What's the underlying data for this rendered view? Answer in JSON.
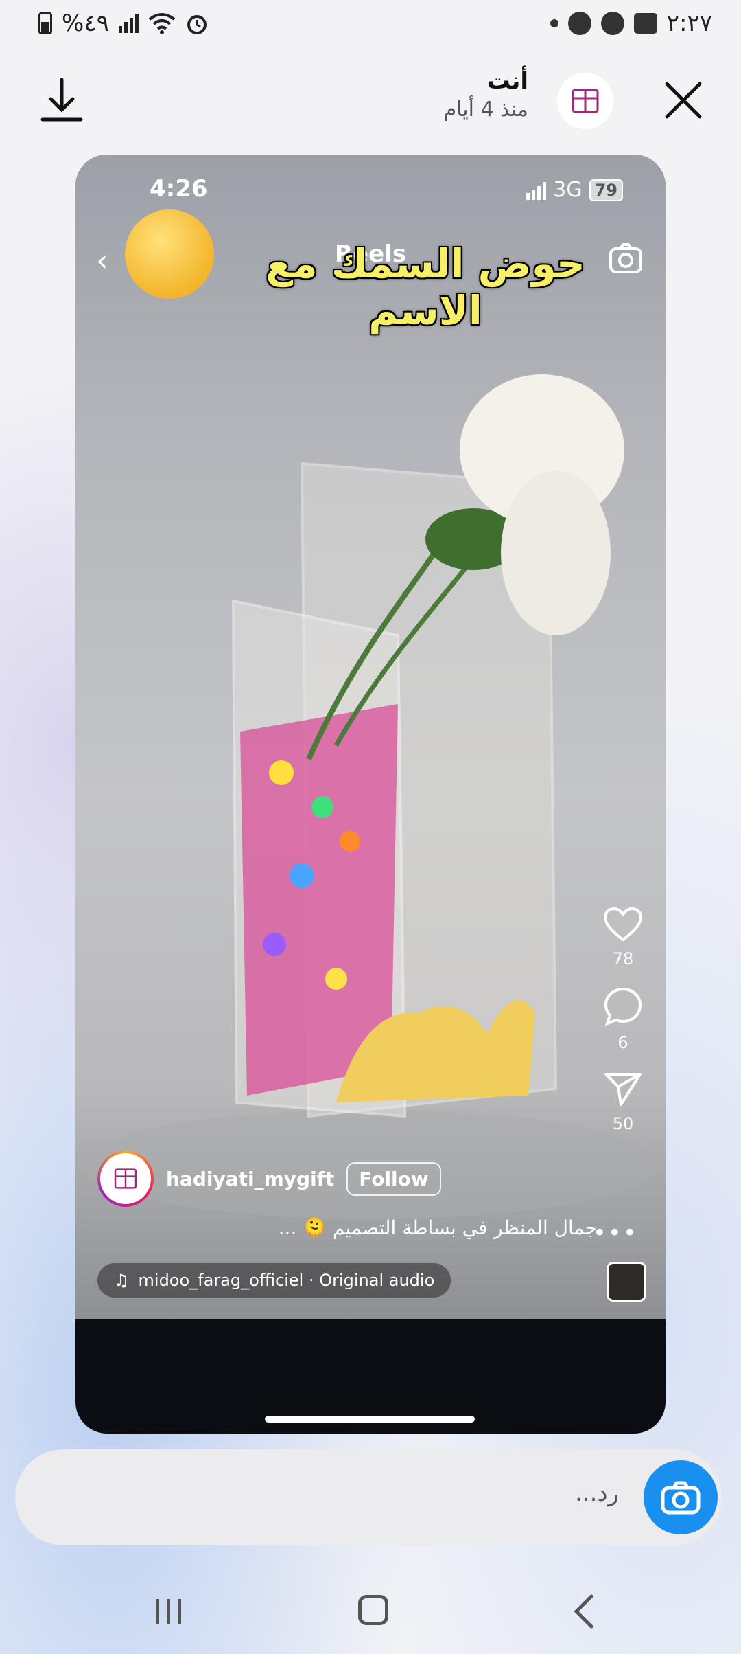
{
  "status_bar": {
    "time": "٢:٢٧",
    "battery_text": "%٤٩"
  },
  "header": {
    "name": "أنت",
    "time_ago": "منذ 4 أيام"
  },
  "reel": {
    "inner_time": "4:26",
    "network": "3G",
    "battery": "79",
    "tab_label": "Reels",
    "overlay_title": "حوض السمك مع الاسم",
    "likes": "78",
    "comments": "6",
    "shares": "50",
    "username": "hadiyati_mygift",
    "follow_label": "Follow",
    "caption": "جمال المنظر في بساطة التصميم 🫠 ...",
    "audio": "midoo_farag_officiel · Original audio"
  },
  "reply": {
    "placeholder": "رد..."
  },
  "colors": {
    "accent": "#1990f0",
    "overlay_text": "#f7f067"
  }
}
